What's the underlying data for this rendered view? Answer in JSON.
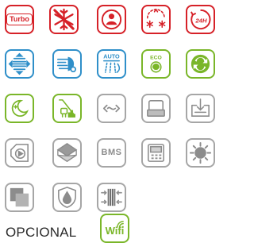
{
  "icons": {
    "turbo": {
      "label": "Turbo",
      "icon": "turbo-icon",
      "color": "#d62128"
    },
    "anti_freeze": {
      "icon": "snowflake-crossed-icon",
      "color": "#d62128"
    },
    "i_feel": {
      "icon": "person-sensor-icon",
      "color": "#d62128"
    },
    "self_clean": {
      "icon": "self-clean-snowflake-icon",
      "color": "#d62128"
    },
    "timer_24h": {
      "label": "24H",
      "icon": "timer-24h-icon",
      "color": "#d62128"
    },
    "swing_vertical": {
      "icon": "vertical-swing-icon",
      "color": "#2f8fc9"
    },
    "airflow": {
      "icon": "airflow-icon",
      "color": "#2f8fc9"
    },
    "auto_mode": {
      "label": "AUTO",
      "icon": "auto-mode-icon",
      "color": "#2f8fc9"
    },
    "eco_mode": {
      "label": "ECO",
      "icon": "eco-mode-icon",
      "color": "#7ab629"
    },
    "energy_saving": {
      "icon": "green-energy-icon",
      "color": "#7ab629"
    },
    "sleep_mode": {
      "icon": "moon-sleep-icon",
      "color": "#7ab629"
    },
    "power_limit": {
      "icon": "power-limit-icon",
      "color": "#7ab629"
    },
    "remote_link": {
      "icon": "link-arrows-icon",
      "color": "#a6a6a6"
    },
    "indoor_unit": {
      "icon": "indoor-unit-icon",
      "color": "#a6a6a6"
    },
    "install_unit": {
      "icon": "install-unit-icon",
      "color": "#a6a6a6"
    },
    "drain_pump": {
      "icon": "drain-pump-icon",
      "color": "#a6a6a6"
    },
    "filter_3d": {
      "icon": "filter-icon",
      "color": "#a6a6a6"
    },
    "bms": {
      "label": "BMS",
      "icon": "bms-icon",
      "color": "#8c8c8c"
    },
    "wired_controller": {
      "icon": "wired-controller-icon",
      "color": "#a6a6a6"
    },
    "sun_heat": {
      "icon": "sun-icon",
      "color": "#a6a6a6"
    },
    "double_filter": {
      "icon": "double-filter-icon",
      "color": "#a6a6a6"
    },
    "anti_corrosion": {
      "icon": "shield-drop-icon",
      "color": "#a6a6a6"
    },
    "fan_coil": {
      "icon": "coil-icon",
      "color": "#a6a6a6"
    }
  },
  "optional": {
    "label": "OPCIONAL",
    "wifi_label": "Wifi",
    "wifi_color": "#7ab629"
  }
}
